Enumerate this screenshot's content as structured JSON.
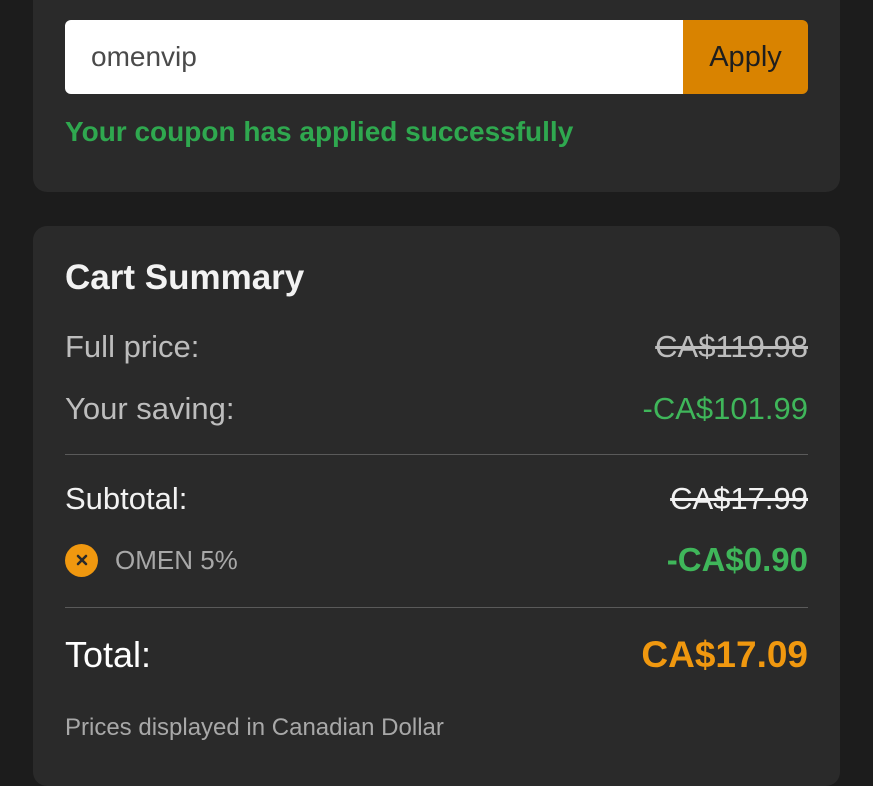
{
  "coupon": {
    "input_value": "omenvip",
    "apply_label": "Apply",
    "success_message": "Your coupon has applied successfully"
  },
  "summary": {
    "title": "Cart Summary",
    "full_price_label": "Full price:",
    "full_price_value": "CA$119.98",
    "saving_label": "Your saving:",
    "saving_value": "-CA$101.99",
    "subtotal_label": "Subtotal:",
    "subtotal_value": "CA$17.99",
    "discount_name": "OMEN 5%",
    "discount_value": "-CA$0.90",
    "total_label": "Total:",
    "total_value": "CA$17.09",
    "footnote": "Prices displayed in Canadian Dollar"
  },
  "colors": {
    "background": "#1c1c1c",
    "card": "#2a2a2a",
    "accent_orange": "#d98300",
    "total_orange": "#f0980f",
    "success_green": "#2fa84f",
    "saving_green": "#3fb65a"
  },
  "icons": {
    "remove_discount": "close-icon"
  }
}
